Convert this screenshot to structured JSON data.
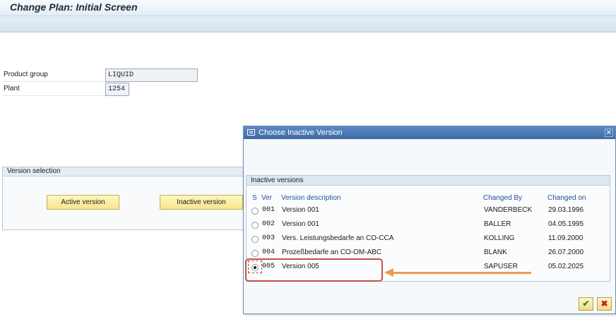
{
  "window": {
    "title": "Change Plan: Initial Screen"
  },
  "form": {
    "product_group": {
      "label": "Product group",
      "value": "LIQUID"
    },
    "plant": {
      "label": "Plant",
      "value": "1254"
    }
  },
  "version_selection": {
    "title": "Version selection",
    "active_button": "Active version",
    "inactive_button": "Inactive version"
  },
  "dialog": {
    "title": "Choose Inactive Version",
    "panel_title": "Inactive versions",
    "columns": {
      "s": "S",
      "ver": "Ver",
      "description": "Version description",
      "changed_by": "Changed By",
      "changed_on": "Changed on"
    },
    "rows": [
      {
        "ver": "001",
        "description": "Version 001",
        "changed_by": "VANDERBECK",
        "changed_on": "29.03.1996",
        "selected": false
      },
      {
        "ver": "002",
        "description": "Version 001",
        "changed_by": "BALLER",
        "changed_on": "04.05.1995",
        "selected": false
      },
      {
        "ver": "003",
        "description": "Vers. Leistungsbedarfe an CO-CCA",
        "changed_by": "KOLLING",
        "changed_on": "11.09.2000",
        "selected": false
      },
      {
        "ver": "004",
        "description": "Prozeßbedarfe an CO-OM-ABC",
        "changed_by": "BLANK",
        "changed_on": "26.07.2000",
        "selected": false
      },
      {
        "ver": "005",
        "description": "Version 005",
        "changed_by": "SAPUSER",
        "changed_on": "05.02.2025",
        "selected": true
      }
    ],
    "ok_symbol": "✔",
    "cancel_symbol": "✖",
    "close_symbol": "✕"
  },
  "colors": {
    "annotation_box": "#c0504d",
    "annotation_arrow": "#ee9a4d",
    "dialog_titlebar": "#4a77b3"
  }
}
